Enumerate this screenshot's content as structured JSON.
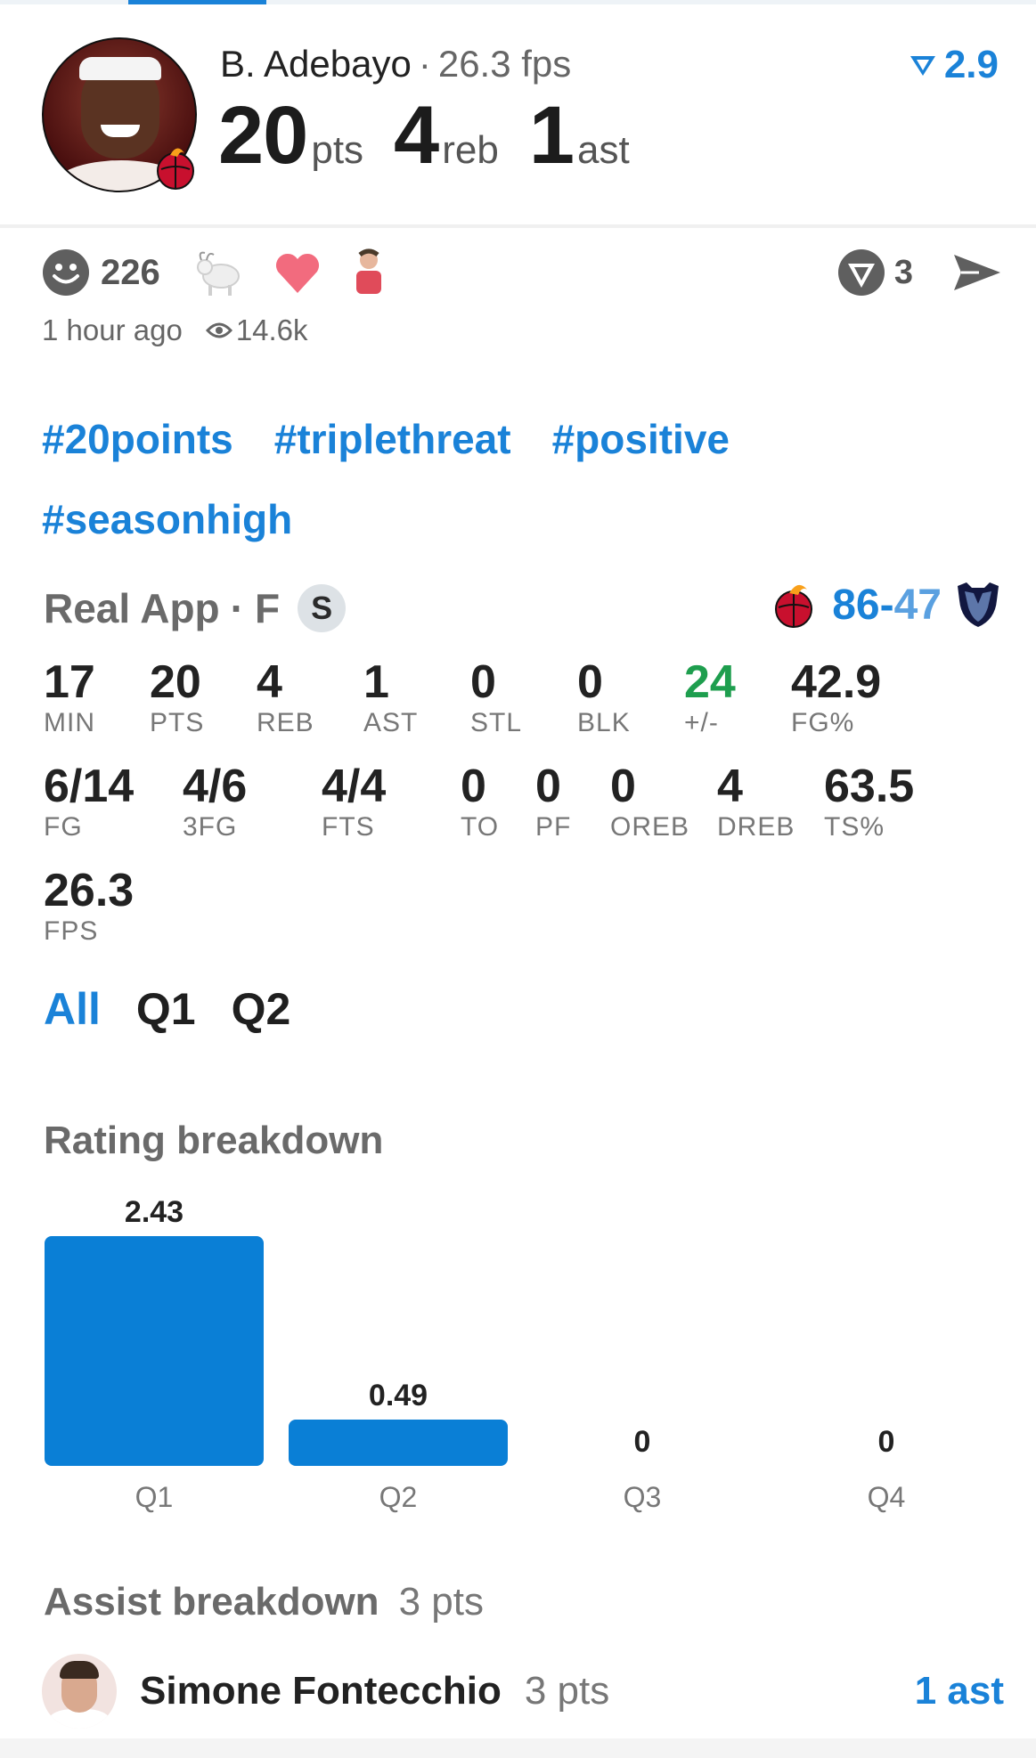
{
  "header": {
    "player_name": "B. Adebayo",
    "separator": "·",
    "fps": "26.3 fps",
    "rating": "2.9",
    "big_stats": [
      {
        "value": "20",
        "unit": "pts"
      },
      {
        "value": "4",
        "unit": "reb"
      },
      {
        "value": "1",
        "unit": "ast"
      }
    ]
  },
  "reactions": {
    "smile_count": "226",
    "icons": [
      "goat-icon",
      "heart-icon",
      "user-sticker-icon"
    ],
    "comments_count": "3"
  },
  "meta": {
    "time_ago": "1 hour ago",
    "views": "14.6k"
  },
  "tags": [
    "#20points",
    "#triplethreat",
    "#positive",
    "#seasonhigh"
  ],
  "game": {
    "source": "Real App",
    "separator": "·",
    "status": "F",
    "badge": "S",
    "home_score": "86",
    "dash": "-",
    "away_score": "47"
  },
  "stats": [
    {
      "value": "17",
      "label": "MIN"
    },
    {
      "value": "20",
      "label": "PTS"
    },
    {
      "value": "4",
      "label": "REB"
    },
    {
      "value": "1",
      "label": "AST"
    },
    {
      "value": "0",
      "label": "STL"
    },
    {
      "value": "0",
      "label": "BLK"
    },
    {
      "value": "24",
      "label": "+/-"
    },
    {
      "value": "42.9",
      "label": "FG%"
    },
    {
      "value": "6/14",
      "label": "FG"
    },
    {
      "value": "4/6",
      "label": "3FG"
    },
    {
      "value": "4/4",
      "label": "FTS"
    },
    {
      "value": "0",
      "label": "TO"
    },
    {
      "value": "0",
      "label": "PF"
    },
    {
      "value": "0",
      "label": "OREB"
    },
    {
      "value": "4",
      "label": "DREB"
    },
    {
      "value": "63.5",
      "label": "TS%"
    },
    {
      "value": "26.3",
      "label": "FPS"
    }
  ],
  "quarter_tabs": [
    "All",
    "Q1",
    "Q2"
  ],
  "active_tab": "All",
  "rating_breakdown_title": "Rating breakdown",
  "chart_data": {
    "type": "bar",
    "categories": [
      "Q1",
      "Q2",
      "Q3",
      "Q4"
    ],
    "values": [
      2.43,
      0.49,
      0,
      0
    ],
    "data_labels": [
      "2.43",
      "0.49",
      "0",
      "0"
    ],
    "title": "",
    "xlabel": "",
    "ylabel": "",
    "ylim": [
      0,
      2.43
    ],
    "grid": false,
    "bar_color": "#0a7fd6"
  },
  "assist": {
    "title": "Assist breakdown",
    "total": "3 pts",
    "rows": [
      {
        "name": "Simone Fontecchio",
        "pts": "3 pts",
        "ast": "1 ast"
      }
    ]
  },
  "colors": {
    "accent": "#1a82d8",
    "positive": "#1e9e4e",
    "heat_red": "#c8102e",
    "grizzlies_navy": "#12173f"
  }
}
